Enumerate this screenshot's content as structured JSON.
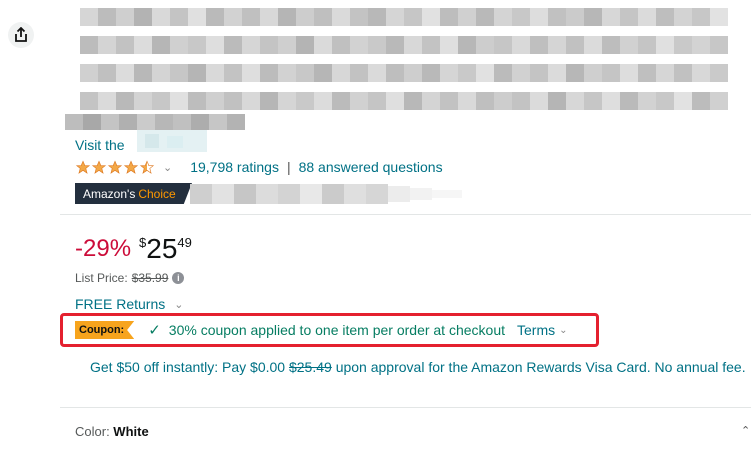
{
  "header": {
    "share_icon": "share-icon"
  },
  "brand": {
    "visit_text": "Visit the"
  },
  "rating": {
    "stars_value": 4.5,
    "ratings_link": "19,798 ratings",
    "separator": "|",
    "answered_link": "88 answered questions"
  },
  "badge": {
    "prefix": "Amazon's",
    "choice": "Choice"
  },
  "price": {
    "discount": "-29%",
    "currency": "$",
    "whole": "25",
    "fraction": "49",
    "list_label": "List Price:",
    "list_value": "$35.99"
  },
  "returns": {
    "label": "FREE Returns"
  },
  "coupon": {
    "tag": "Coupon:",
    "text": "30% coupon applied to one item per order at checkout",
    "terms": "Terms"
  },
  "rewards": {
    "text_before": "Get $50 off instantly: Pay $0.00 ",
    "strike": "$25.49",
    "text_after": " upon approval for the Amazon Rewards Visa Card. No annual fee."
  },
  "color": {
    "label": "Color: ",
    "value": "White"
  },
  "colors": {
    "link": "#007185",
    "deal_red": "#cc0c39",
    "star": "#f3a847",
    "coupon_green": "#067d62",
    "highlight_red": "#e4202f"
  }
}
